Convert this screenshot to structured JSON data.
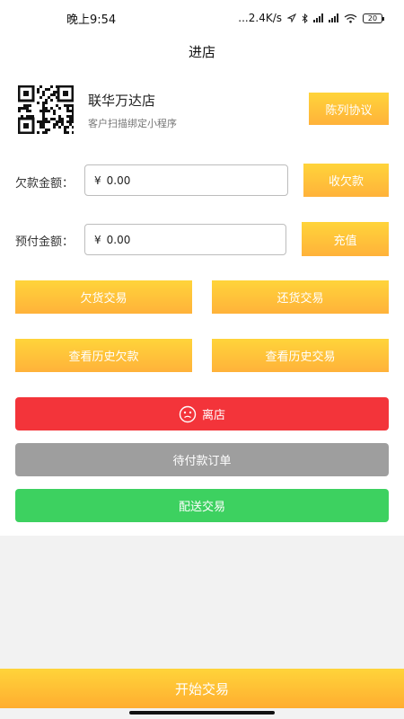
{
  "status_bar": {
    "time": "晚上9:54",
    "network": "...2.4K/s",
    "icons": [
      "location-arrow-icon",
      "bluetooth-icon",
      "signal-icon",
      "wifi-icon"
    ],
    "battery": "20"
  },
  "nav": {
    "title": "进店"
  },
  "store": {
    "name": "联华万达店",
    "subtitle": "客户扫描绑定小程序",
    "agreement_button": "陈列协议"
  },
  "debt": {
    "label": "欠款金额：",
    "currency": "¥",
    "value": "0.00",
    "button": "收欠款"
  },
  "prepaid": {
    "label": "预付金额：",
    "currency": "¥",
    "value": "0.00",
    "button": "充值"
  },
  "actions": {
    "credit_trade": "欠货交易",
    "return_trade": "还货交易",
    "history_debt": "查看历史欠款",
    "history_trade": "查看历史交易"
  },
  "buttons": {
    "leave": "离店",
    "pending_orders": "待付款订单",
    "delivery": "配送交易"
  },
  "bottom": {
    "start_trade": "开始交易"
  },
  "colors": {
    "accent_yellow": "#ffc63a",
    "red": "#f3343a",
    "grey": "#9e9e9e",
    "green": "#3dd160"
  }
}
